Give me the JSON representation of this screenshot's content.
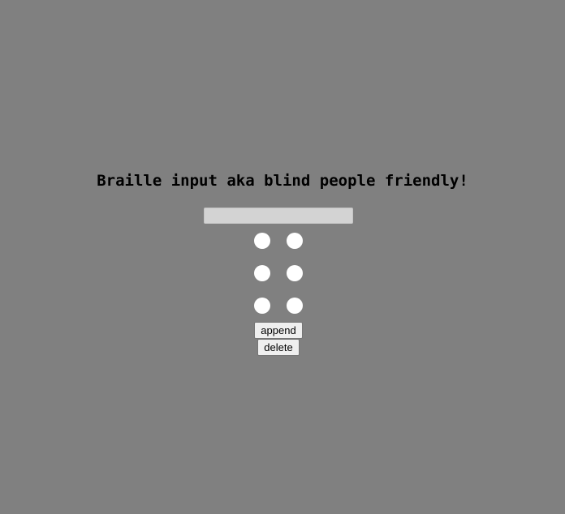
{
  "heading": "Braille input aka blind people friendly!",
  "input": {
    "value": "",
    "placeholder": ""
  },
  "braille_cell": {
    "dots": [
      {
        "number": 1,
        "state": "off"
      },
      {
        "number": 2,
        "state": "off"
      },
      {
        "number": 3,
        "state": "off"
      },
      {
        "number": 4,
        "state": "off"
      },
      {
        "number": 5,
        "state": "off"
      },
      {
        "number": 6,
        "state": "off"
      }
    ],
    "dot_color": "#ffffff"
  },
  "buttons": {
    "append_label": "append",
    "delete_label": "delete"
  },
  "colors": {
    "background": "#808080",
    "input_background": "#d3d3d3"
  }
}
